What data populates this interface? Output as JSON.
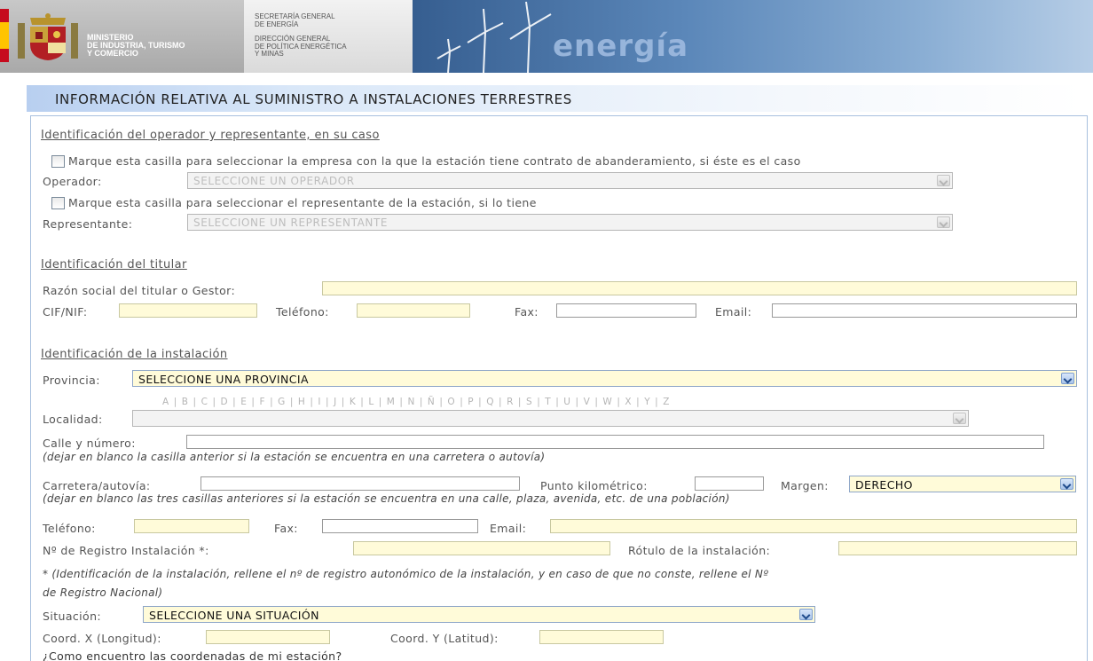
{
  "header": {
    "ministry_lines": [
      "MINISTERIO",
      "DE INDUSTRIA, TURISMO",
      "Y COMERCIO"
    ],
    "secretaria_lines": [
      "SECRETARÍA GENERAL",
      "DE ENERGÍA"
    ],
    "direccion_lines": [
      "DIRECCIÓN GENERAL",
      "DE POLÍTICA ENERGÉTICA",
      "Y MINAS"
    ],
    "brand_word": "energía",
    "colors": {
      "banner_blue": "#5b87b9",
      "flag_red": "#c60b1e",
      "flag_yellow": "#ffc400"
    }
  },
  "page_title": "INFORMACIÓN RELATIVA AL SUMINISTRO A INSTALACIONES TERRESTRES",
  "operador_section": {
    "heading": "Identificación del operador y representante, en su caso",
    "checkbox_operador_label": "Marque esta casilla para seleccionar la empresa con la que la estación tiene contrato de abanderamiento, si éste es el caso",
    "operador_label": "Operador:",
    "operador_value": "SELECCIONE UN OPERADOR",
    "checkbox_representante_label": "Marque esta casilla para seleccionar el representante de la estación, si lo tiene",
    "representante_label": "Representante:",
    "representante_value": "SELECCIONE UN REPRESENTANTE"
  },
  "titular_section": {
    "heading": "Identificación del titular",
    "razon_label": "Razón social del titular o Gestor:",
    "cif_label": "CIF/NIF:",
    "telefono_label": "Teléfono:",
    "fax_label": "Fax:",
    "email_label": "Email:"
  },
  "instalacion_section": {
    "heading": "Identificación de la instalación",
    "provincia_label": "Provincia:",
    "provincia_value": "SELECCIONE UNA PROVINCIA",
    "alphabet": "A | B | C | D | E | F | G | H | I | J | K | L | M | N | Ñ | O | P | Q | R | S | T | U | V | W | X | Y | Z",
    "localidad_label": "Localidad:",
    "calle_label": "Calle y número:",
    "calle_note": "(dejar en blanco la casilla anterior si la estación se encuentra en una carretera o autovía)",
    "carretera_label": "Carretera/autovía:",
    "pk_label": "Punto kilométrico:",
    "margen_label": "Margen:",
    "margen_value": "DERECHO",
    "carretera_note": "(dejar en blanco las tres casillas anteriores si la estación se encuentra en una calle, plaza, avenida, etc. de una población)",
    "telefono_label": "Teléfono:",
    "fax_label": "Fax:",
    "email_label": "Email:",
    "registro_label": "Nº de Registro Instalación *:",
    "rotulo_label": "Rótulo de la instalación:",
    "registro_note_line1": "* (Identificación de la instalación, rellene el nº de registro autonómico de la instalación, y en caso de que no conste, rellene el Nº",
    "registro_note_line2": "de Registro Nacional)",
    "situacion_label": "Situación:",
    "situacion_value": "SELECCIONE UNA SITUACIÓN",
    "coord_x_label": "Coord. X (Longitud):",
    "coord_y_label": "Coord. Y (Latitud):",
    "coords_help": "¿Como encuentro las coordenadas de mi estación?"
  }
}
